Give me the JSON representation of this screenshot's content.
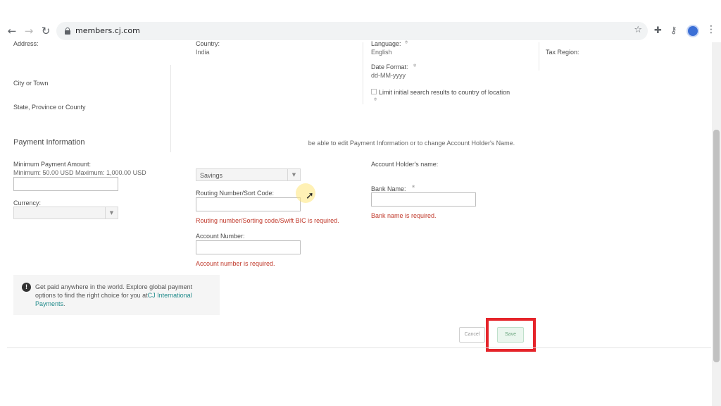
{
  "browser": {
    "url": "members.cj.com"
  },
  "locale": {
    "address_label": "Address:",
    "country_label": "Country:",
    "country_value": "India",
    "language_label": "Language:",
    "language_value": "English",
    "tax_region_label": "Tax Region:",
    "date_format_label": "Date Format:",
    "date_format_value": "dd-MM-yyyy",
    "limit_search_label": "Limit initial search results to country of location",
    "city_label": "City or Town",
    "state_label": "State, Province or County"
  },
  "payment": {
    "section_title": "Payment Information",
    "edit_notice": " be able to edit Payment Information or to change Account Holder's Name.",
    "min_amount_label": "Minimum Payment Amount:",
    "min_amount_range": "Minimum: 50.00 USD Maximum: 1,000.00 USD",
    "min_amount_value": "",
    "currency_label": "Currency:",
    "currency_value": "",
    "account_type_value": "Savings",
    "routing_label": "Routing Number/Sort Code:",
    "routing_value": "",
    "routing_error": "Routing number/Sorting code/Swift BIC is required.",
    "account_number_label": "Account Number:",
    "account_number_value": "",
    "account_number_error": "Account number is required.",
    "account_holder_label": "Account Holder's name:",
    "bank_name_label": "Bank Name:",
    "bank_name_value": "",
    "bank_name_error": "Bank name is required."
  },
  "info": {
    "text": "Get paid anywhere in the world. Explore global payment options to find the right choice for you at",
    "link": "CJ International Payments",
    "suffix": "."
  },
  "actions": {
    "cancel": "Cancel",
    "save": "Save"
  },
  "colors": {
    "error": "#c0392b",
    "highlight": "#e5242a",
    "link": "#1f8a8a"
  }
}
